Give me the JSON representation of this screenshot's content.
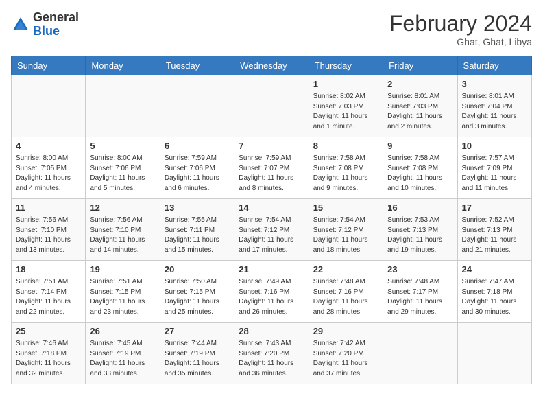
{
  "header": {
    "logo_general": "General",
    "logo_blue": "Blue",
    "month_year": "February 2024",
    "location": "Ghat, Ghat, Libya"
  },
  "days_of_week": [
    "Sunday",
    "Monday",
    "Tuesday",
    "Wednesday",
    "Thursday",
    "Friday",
    "Saturday"
  ],
  "weeks": [
    [
      {
        "num": "",
        "info": ""
      },
      {
        "num": "",
        "info": ""
      },
      {
        "num": "",
        "info": ""
      },
      {
        "num": "",
        "info": ""
      },
      {
        "num": "1",
        "info": "Sunrise: 8:02 AM\nSunset: 7:03 PM\nDaylight: 11 hours and 1 minute."
      },
      {
        "num": "2",
        "info": "Sunrise: 8:01 AM\nSunset: 7:03 PM\nDaylight: 11 hours and 2 minutes."
      },
      {
        "num": "3",
        "info": "Sunrise: 8:01 AM\nSunset: 7:04 PM\nDaylight: 11 hours and 3 minutes."
      }
    ],
    [
      {
        "num": "4",
        "info": "Sunrise: 8:00 AM\nSunset: 7:05 PM\nDaylight: 11 hours and 4 minutes."
      },
      {
        "num": "5",
        "info": "Sunrise: 8:00 AM\nSunset: 7:06 PM\nDaylight: 11 hours and 5 minutes."
      },
      {
        "num": "6",
        "info": "Sunrise: 7:59 AM\nSunset: 7:06 PM\nDaylight: 11 hours and 6 minutes."
      },
      {
        "num": "7",
        "info": "Sunrise: 7:59 AM\nSunset: 7:07 PM\nDaylight: 11 hours and 8 minutes."
      },
      {
        "num": "8",
        "info": "Sunrise: 7:58 AM\nSunset: 7:08 PM\nDaylight: 11 hours and 9 minutes."
      },
      {
        "num": "9",
        "info": "Sunrise: 7:58 AM\nSunset: 7:08 PM\nDaylight: 11 hours and 10 minutes."
      },
      {
        "num": "10",
        "info": "Sunrise: 7:57 AM\nSunset: 7:09 PM\nDaylight: 11 hours and 11 minutes."
      }
    ],
    [
      {
        "num": "11",
        "info": "Sunrise: 7:56 AM\nSunset: 7:10 PM\nDaylight: 11 hours and 13 minutes."
      },
      {
        "num": "12",
        "info": "Sunrise: 7:56 AM\nSunset: 7:10 PM\nDaylight: 11 hours and 14 minutes."
      },
      {
        "num": "13",
        "info": "Sunrise: 7:55 AM\nSunset: 7:11 PM\nDaylight: 11 hours and 15 minutes."
      },
      {
        "num": "14",
        "info": "Sunrise: 7:54 AM\nSunset: 7:12 PM\nDaylight: 11 hours and 17 minutes."
      },
      {
        "num": "15",
        "info": "Sunrise: 7:54 AM\nSunset: 7:12 PM\nDaylight: 11 hours and 18 minutes."
      },
      {
        "num": "16",
        "info": "Sunrise: 7:53 AM\nSunset: 7:13 PM\nDaylight: 11 hours and 19 minutes."
      },
      {
        "num": "17",
        "info": "Sunrise: 7:52 AM\nSunset: 7:13 PM\nDaylight: 11 hours and 21 minutes."
      }
    ],
    [
      {
        "num": "18",
        "info": "Sunrise: 7:51 AM\nSunset: 7:14 PM\nDaylight: 11 hours and 22 minutes."
      },
      {
        "num": "19",
        "info": "Sunrise: 7:51 AM\nSunset: 7:15 PM\nDaylight: 11 hours and 23 minutes."
      },
      {
        "num": "20",
        "info": "Sunrise: 7:50 AM\nSunset: 7:15 PM\nDaylight: 11 hours and 25 minutes."
      },
      {
        "num": "21",
        "info": "Sunrise: 7:49 AM\nSunset: 7:16 PM\nDaylight: 11 hours and 26 minutes."
      },
      {
        "num": "22",
        "info": "Sunrise: 7:48 AM\nSunset: 7:16 PM\nDaylight: 11 hours and 28 minutes."
      },
      {
        "num": "23",
        "info": "Sunrise: 7:48 AM\nSunset: 7:17 PM\nDaylight: 11 hours and 29 minutes."
      },
      {
        "num": "24",
        "info": "Sunrise: 7:47 AM\nSunset: 7:18 PM\nDaylight: 11 hours and 30 minutes."
      }
    ],
    [
      {
        "num": "25",
        "info": "Sunrise: 7:46 AM\nSunset: 7:18 PM\nDaylight: 11 hours and 32 minutes."
      },
      {
        "num": "26",
        "info": "Sunrise: 7:45 AM\nSunset: 7:19 PM\nDaylight: 11 hours and 33 minutes."
      },
      {
        "num": "27",
        "info": "Sunrise: 7:44 AM\nSunset: 7:19 PM\nDaylight: 11 hours and 35 minutes."
      },
      {
        "num": "28",
        "info": "Sunrise: 7:43 AM\nSunset: 7:20 PM\nDaylight: 11 hours and 36 minutes."
      },
      {
        "num": "29",
        "info": "Sunrise: 7:42 AM\nSunset: 7:20 PM\nDaylight: 11 hours and 37 minutes."
      },
      {
        "num": "",
        "info": ""
      },
      {
        "num": "",
        "info": ""
      }
    ]
  ]
}
